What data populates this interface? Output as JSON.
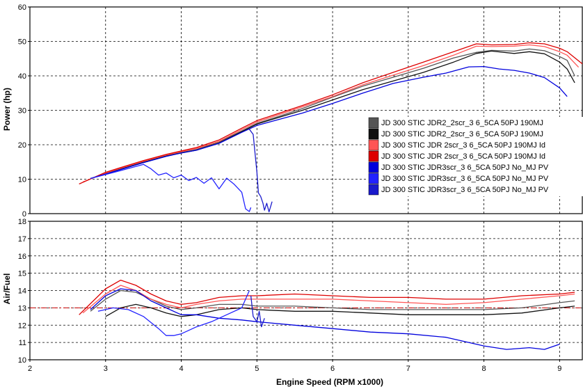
{
  "chart_data": [
    {
      "type": "line",
      "ylabel": "Power (hp)",
      "xlim": [
        2,
        9.3
      ],
      "ylim": [
        0,
        60
      ],
      "yticks": [
        0,
        10,
        20,
        30,
        40,
        50,
        60
      ],
      "grid": true,
      "legend_position": "right",
      "series": [
        {
          "name": "JD 300 STIC JDR2_2scr_3 6_5CA 50PJ 190MJ",
          "color": "#555555",
          "x": [
            2.8,
            3.0,
            3.2,
            3.5,
            3.8,
            4.0,
            4.2,
            4.5,
            4.8,
            5.0,
            5.3,
            5.6,
            6.0,
            6.4,
            6.8,
            7.2,
            7.6,
            7.9,
            8.1,
            8.4,
            8.6,
            8.8,
            9.0,
            9.1,
            9.2
          ],
          "y": [
            10.2,
            11.6,
            13.0,
            15.0,
            16.8,
            17.8,
            18.6,
            20.8,
            24.0,
            26.2,
            28.3,
            30.5,
            33.8,
            37.0,
            39.6,
            42.2,
            45.2,
            46.8,
            47.4,
            47.2,
            47.8,
            47.3,
            45.6,
            44.5,
            40.0
          ]
        },
        {
          "name": "JD 300 STIC JDR2_2scr_3 6_5CA 50PJ 190MJ",
          "color": "#111111",
          "x": [
            2.8,
            3.0,
            3.2,
            3.5,
            3.8,
            4.0,
            4.2,
            4.5,
            4.8,
            5.0,
            5.3,
            5.6,
            6.0,
            6.4,
            6.8,
            7.2,
            7.6,
            7.9,
            8.1,
            8.4,
            8.6,
            8.8,
            9.0,
            9.1,
            9.2
          ],
          "y": [
            10.2,
            11.5,
            12.9,
            14.9,
            16.7,
            17.6,
            18.4,
            20.5,
            23.8,
            26.0,
            28.0,
            30.0,
            33.0,
            36.0,
            38.5,
            41.0,
            44.0,
            46.5,
            47.2,
            46.5,
            47.0,
            46.4,
            44.0,
            42.0,
            38.0
          ]
        },
        {
          "name": "JD 300 STIC JDR 2scr_3 6_5CA 50PJ 190MJ Id",
          "color": "#ff5555",
          "x": [
            2.7,
            3.0,
            3.2,
            3.5,
            3.8,
            4.0,
            4.2,
            4.5,
            4.8,
            5.0,
            5.3,
            5.6,
            6.0,
            6.4,
            6.8,
            7.2,
            7.6,
            7.9,
            8.1,
            8.4,
            8.6,
            8.8,
            9.0,
            9.1,
            9.25
          ],
          "y": [
            9.2,
            11.8,
            13.2,
            15.2,
            17.0,
            18.0,
            18.9,
            21.0,
            24.4,
            26.6,
            28.8,
            31.0,
            34.0,
            37.4,
            40.2,
            43.0,
            46.0,
            48.6,
            48.5,
            48.6,
            49.0,
            48.5,
            47.0,
            46.0,
            42.5
          ]
        },
        {
          "name": "JD 300 STIC JDR 2scr_3 6_5CA 50PJ 190MJ Id",
          "color": "#dd0000",
          "x": [
            2.65,
            3.0,
            3.2,
            3.5,
            3.8,
            4.0,
            4.2,
            4.5,
            4.8,
            5.0,
            5.3,
            5.6,
            6.0,
            6.4,
            6.8,
            7.2,
            7.6,
            7.9,
            8.1,
            8.4,
            8.6,
            8.8,
            9.0,
            9.1,
            9.3
          ],
          "y": [
            8.6,
            12.0,
            13.4,
            15.4,
            17.2,
            18.2,
            19.2,
            21.4,
            24.8,
            27.0,
            29.2,
            31.4,
            34.5,
            38.0,
            41.0,
            44.0,
            47.0,
            49.3,
            49.0,
            49.1,
            49.6,
            49.3,
            48.0,
            47.0,
            43.5
          ]
        },
        {
          "name": "JD 300 STIC JDR3scr_3 6_5CA 50PJ No_MJ PV",
          "color": "#0000dd",
          "x": [
            2.8,
            3.0,
            3.2,
            3.5,
            3.8,
            4.0,
            4.2,
            4.5,
            4.8,
            5.0,
            5.3,
            5.6,
            6.0,
            6.4,
            6.8,
            7.2,
            7.5,
            7.8,
            8.0,
            8.2,
            8.4,
            8.6,
            8.8,
            9.0,
            9.1
          ],
          "y": [
            10.2,
            11.5,
            12.8,
            14.8,
            16.6,
            17.6,
            18.4,
            20.4,
            23.6,
            25.6,
            27.4,
            29.2,
            32.0,
            35.0,
            37.8,
            39.6,
            40.8,
            42.6,
            42.7,
            42.0,
            41.6,
            40.8,
            39.5,
            36.5,
            34.0
          ]
        },
        {
          "name": "JD 300 STIC JDR3scr_3 6_5CA 50PJ No_MJ PV",
          "color": "#2222ff",
          "x": [
            2.8,
            3.2,
            3.5,
            3.6,
            3.7,
            3.8,
            3.9,
            4.0,
            4.1,
            4.2,
            4.3,
            4.4,
            4.5,
            4.6,
            4.7,
            4.8,
            4.85,
            4.9,
            4.92
          ],
          "y": [
            10.2,
            12.5,
            14.3,
            13.0,
            11.2,
            11.8,
            10.4,
            11.2,
            9.6,
            10.5,
            8.8,
            10.4,
            7.2,
            10.3,
            8.5,
            6.2,
            1.4,
            0.6,
            1.8
          ]
        },
        {
          "name": "JD 300 STIC JDR3scr_3 6_5CA 50PJ No_MJ PV",
          "color": "#1a1acc",
          "x": [
            4.9,
            4.95,
            5.0,
            5.02,
            5.05,
            5.08,
            5.1,
            5.13,
            5.16,
            5.2
          ],
          "y": [
            24.5,
            23.0,
            12.0,
            6.0,
            5.0,
            3.0,
            1.0,
            3.0,
            0.5,
            3.5
          ]
        }
      ]
    },
    {
      "type": "line",
      "xlabel": "Engine Speed (RPM x1000)",
      "ylabel": "Air/Fuel",
      "xlim": [
        2,
        9.3
      ],
      "ylim": [
        10,
        18
      ],
      "xticks": [
        2,
        3,
        4,
        5,
        6,
        7,
        8,
        9
      ],
      "yticks": [
        10,
        11,
        12,
        13,
        14,
        15,
        16,
        17,
        18
      ],
      "grid": true,
      "reference_line": {
        "y": 13,
        "color": "#cc0000",
        "style": "dash-dot"
      },
      "series": [
        {
          "name": "JD 300 STIC JDR2_2scr_3 6_5CA 50PJ 190MJ",
          "color": "#555555",
          "x": [
            2.8,
            3.0,
            3.2,
            3.4,
            3.6,
            3.8,
            4.0,
            4.2,
            4.5,
            4.8,
            5.0,
            5.5,
            6.0,
            6.5,
            7.0,
            7.5,
            8.0,
            8.5,
            9.0,
            9.2
          ],
          "y": [
            12.8,
            13.5,
            14.0,
            13.9,
            13.5,
            13.1,
            12.9,
            13.0,
            13.2,
            13.2,
            13.1,
            13.1,
            13.0,
            12.9,
            12.9,
            12.9,
            12.9,
            13.0,
            13.3,
            13.4
          ]
        },
        {
          "name": "JD 300 STIC JDR2_2scr_3 6_5CA 50PJ 190MJ",
          "color": "#111111",
          "x": [
            3.0,
            3.2,
            3.4,
            3.6,
            3.8,
            4.0,
            4.2,
            4.5,
            4.8,
            5.0,
            5.5,
            6.0,
            6.5,
            7.0,
            7.5,
            8.0,
            8.5,
            9.0,
            9.2
          ],
          "y": [
            12.5,
            13.0,
            13.2,
            13.0,
            12.7,
            12.5,
            12.6,
            12.9,
            13.0,
            12.9,
            12.8,
            12.8,
            12.7,
            12.6,
            12.6,
            12.6,
            12.7,
            13.0,
            13.1
          ]
        },
        {
          "name": "JD 300 STIC JDR 2scr_3 6_5CA 50PJ 190MJ Id",
          "color": "#ff5555",
          "x": [
            2.7,
            3.0,
            3.2,
            3.4,
            3.6,
            3.8,
            4.0,
            4.2,
            4.5,
            4.8,
            5.0,
            5.5,
            6.0,
            6.5,
            7.0,
            7.5,
            8.0,
            8.5,
            9.0,
            9.2
          ],
          "y": [
            12.7,
            13.8,
            14.3,
            14.0,
            13.5,
            13.2,
            13.0,
            13.2,
            13.4,
            13.5,
            13.5,
            13.5,
            13.5,
            13.4,
            13.3,
            13.2,
            13.3,
            13.5,
            13.7,
            13.8
          ]
        },
        {
          "name": "JD 300 STIC JDR 2scr_3 6_5CA 50PJ 190MJ Id",
          "color": "#dd0000",
          "x": [
            2.65,
            3.0,
            3.2,
            3.4,
            3.6,
            3.8,
            4.0,
            4.2,
            4.5,
            4.8,
            5.0,
            5.5,
            6.0,
            6.5,
            7.0,
            7.5,
            8.0,
            8.5,
            9.0,
            9.2
          ],
          "y": [
            12.6,
            14.1,
            14.6,
            14.3,
            13.8,
            13.4,
            13.2,
            13.3,
            13.6,
            13.7,
            13.7,
            13.8,
            13.7,
            13.6,
            13.6,
            13.5,
            13.5,
            13.7,
            13.8,
            13.9
          ]
        },
        {
          "name": "JD 300 STIC JDR3scr_3 6_5CA 50PJ No_MJ PV",
          "color": "#0000dd",
          "x": [
            2.8,
            3.0,
            3.2,
            3.4,
            3.6,
            3.8,
            4.0,
            4.2,
            4.5,
            4.8,
            5.0,
            5.5,
            6.0,
            6.5,
            7.0,
            7.5,
            8.0,
            8.3,
            8.6,
            8.8,
            9.0
          ],
          "y": [
            12.9,
            13.7,
            14.1,
            14.0,
            13.4,
            13.0,
            12.6,
            12.6,
            12.4,
            12.3,
            12.2,
            12.0,
            11.8,
            11.6,
            11.5,
            11.3,
            10.8,
            10.6,
            10.7,
            10.6,
            10.9
          ]
        },
        {
          "name": "JD 300 STIC JDR3scr_3 6_5CA 50PJ No_MJ PV",
          "color": "#2222ff",
          "x": [
            2.9,
            3.1,
            3.3,
            3.5,
            3.7,
            3.8,
            3.9,
            4.0,
            4.1,
            4.2,
            4.4,
            4.6,
            4.8,
            4.9
          ],
          "y": [
            12.8,
            13.0,
            12.9,
            12.5,
            11.8,
            11.4,
            11.4,
            11.5,
            11.7,
            11.9,
            12.2,
            12.6,
            13.0,
            14.0
          ]
        },
        {
          "name": "JD 300 STIC JDR3scr_3 6_5CA 50PJ No_MJ PV",
          "color": "#1a1acc",
          "x": [
            4.92,
            4.95,
            5.0,
            5.03,
            5.06,
            5.1
          ],
          "y": [
            13.7,
            12.5,
            12.2,
            12.8,
            11.9,
            12.4
          ]
        }
      ]
    }
  ]
}
